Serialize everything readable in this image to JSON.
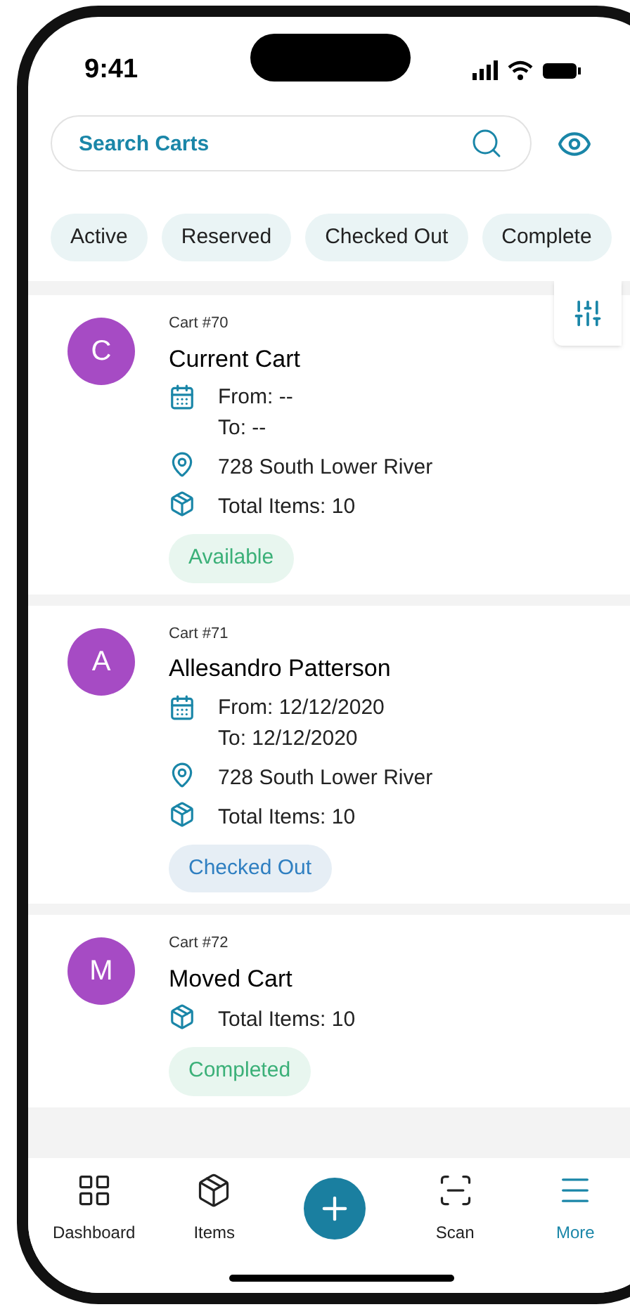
{
  "status_bar": {
    "time": "9:41"
  },
  "search": {
    "placeholder": "Search Carts"
  },
  "filters": [
    {
      "label": "Active"
    },
    {
      "label": "Reserved"
    },
    {
      "label": "Checked Out"
    },
    {
      "label": "Complete"
    }
  ],
  "carts": [
    {
      "number": "Cart #70",
      "initial": "C",
      "name": "Current Cart",
      "from": "From: --",
      "to": "To: --",
      "address": "728 South Lower River",
      "items": "Total Items: 10",
      "status": "Available",
      "kind": "green"
    },
    {
      "number": "Cart #71",
      "initial": "A",
      "name": "Allesandro Patterson",
      "from": "From: 12/12/2020",
      "to": "To: 12/12/2020",
      "address": "728 South Lower River",
      "items": "Total Items: 10",
      "status": "Checked Out",
      "kind": "blue"
    },
    {
      "number": "Cart #72",
      "initial": "M",
      "name": "Moved Cart",
      "items": "Total Items: 10",
      "status": "Completed",
      "kind": "green"
    }
  ],
  "nav": [
    {
      "label": "Dashboard",
      "kind": "grid",
      "selected": false
    },
    {
      "label": "Items",
      "kind": "box",
      "selected": false
    },
    {
      "kind": "add",
      "selected": false
    },
    {
      "label": "Scan",
      "kind": "scan",
      "selected": false
    },
    {
      "label": "More",
      "kind": "menu",
      "selected": true
    }
  ]
}
